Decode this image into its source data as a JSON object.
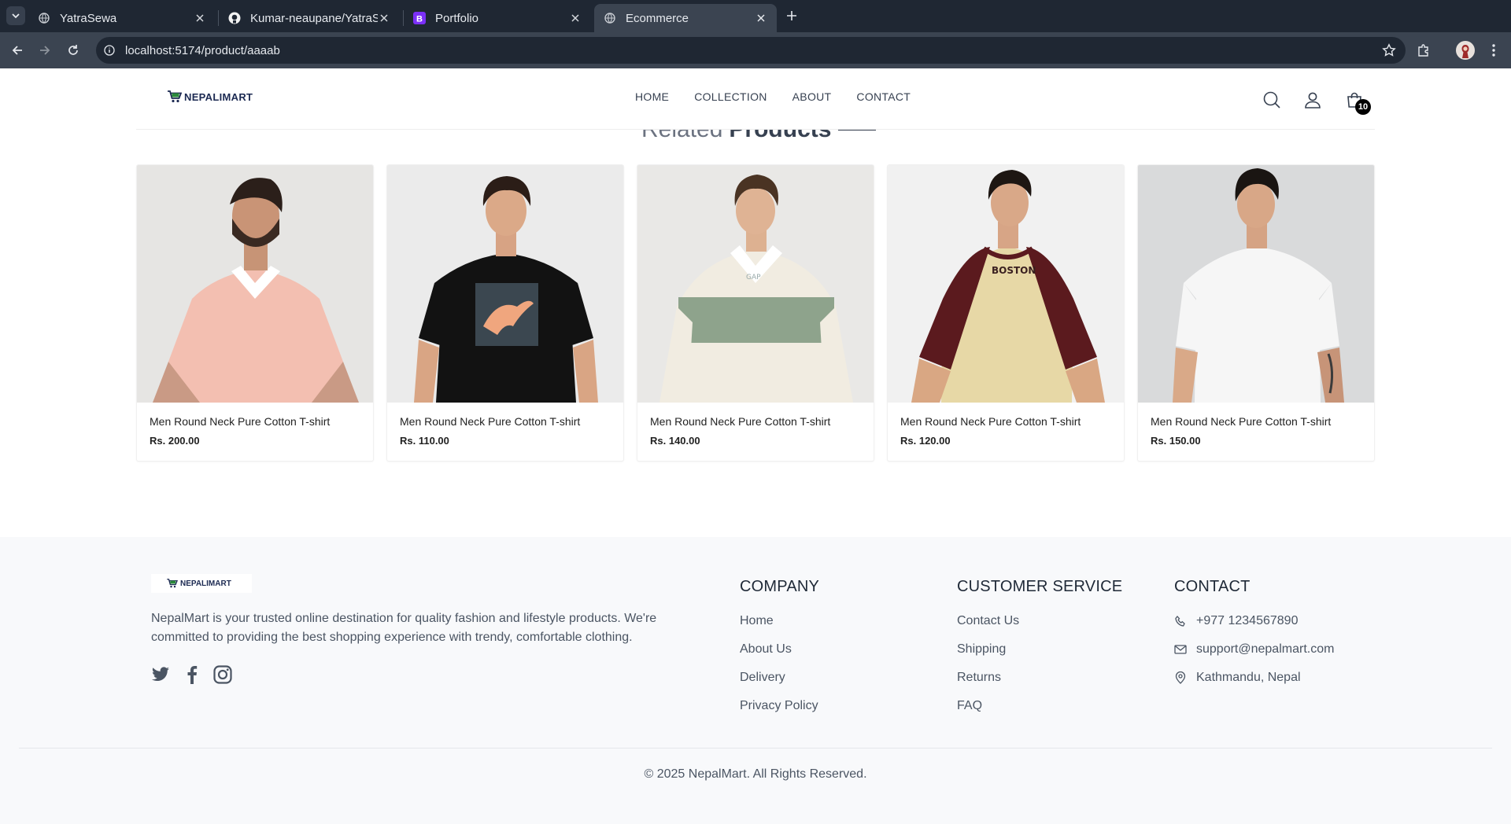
{
  "browser": {
    "tabs": [
      {
        "title": "YatraSewa",
        "active": false
      },
      {
        "title": "Kumar-neaupane/YatraS",
        "active": false
      },
      {
        "title": "Portfolio",
        "active": false
      },
      {
        "title": "Ecommerce",
        "active": true
      }
    ],
    "url": "localhost:5174/product/aaaab"
  },
  "header": {
    "brand": "NEPALIMART",
    "nav": [
      "HOME",
      "COLLECTION",
      "ABOUT",
      "CONTACT"
    ],
    "cart_count": "10"
  },
  "related": {
    "title_light": "Related",
    "title_strong": "Products",
    "products": [
      {
        "name": "Men Round Neck Pure Cotton T-shirt",
        "price": "Rs. 200.00",
        "image": "pink-polo-shirt"
      },
      {
        "name": "Men Round Neck Pure Cotton T-shirt",
        "price": "Rs. 110.00",
        "image": "black-puma-tshirt"
      },
      {
        "name": "Men Round Neck Pure Cotton T-shirt",
        "price": "Rs. 140.00",
        "image": "cream-green-rugby-shirt"
      },
      {
        "name": "Men Round Neck Pure Cotton T-shirt",
        "price": "Rs. 120.00",
        "image": "boston-raglan-tshirt"
      },
      {
        "name": "Men Round Neck Pure Cotton T-shirt",
        "price": "Rs. 150.00",
        "image": "white-tshirt"
      }
    ]
  },
  "footer": {
    "brand": "NEPALIMART",
    "description": "NepalMart is your trusted online destination for quality fashion and lifestyle products. We're committed to providing the best shopping experience with trendy, comfortable clothing.",
    "company": {
      "title": "COMPANY",
      "links": [
        "Home",
        "About Us",
        "Delivery",
        "Privacy Policy"
      ]
    },
    "service": {
      "title": "CUSTOMER SERVICE",
      "links": [
        "Contact Us",
        "Shipping",
        "Returns",
        "FAQ"
      ]
    },
    "contact": {
      "title": "CONTACT",
      "phone": "+977 1234567890",
      "email": "support@nepalmart.com",
      "address": "Kathmandu, Nepal"
    },
    "copyright": "© 2025 NepalMart. All Rights Reserved."
  }
}
